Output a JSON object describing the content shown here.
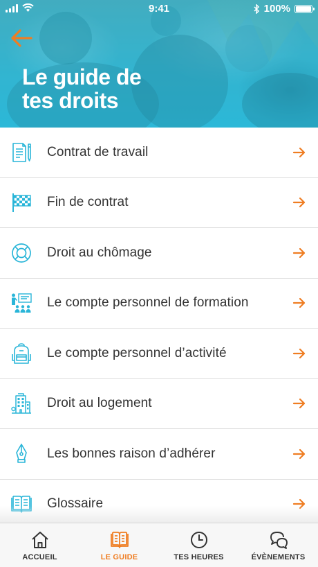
{
  "colors": {
    "accent": "#ef7d22",
    "icon_teal": "#29b5d8",
    "header_blue": "#34b4cf",
    "text": "#333333"
  },
  "status_bar": {
    "time": "9:41",
    "battery": "100%"
  },
  "header": {
    "back_icon": "arrow-left-icon",
    "title_line1": "Le guide de",
    "title_line2": "tes droits"
  },
  "list": {
    "items": [
      {
        "label": "Contrat de travail",
        "icon": "contract-document-icon"
      },
      {
        "label": "Fin de contrat",
        "icon": "checkered-flag-icon"
      },
      {
        "label": "Droit au chômage",
        "icon": "lifebuoy-icon"
      },
      {
        "label": "Le compte personnel de formation",
        "icon": "training-presentation-icon"
      },
      {
        "label": "Le compte personnel d’activité",
        "icon": "backpack-icon"
      },
      {
        "label": "Droit au logement",
        "icon": "building-icon"
      },
      {
        "label": "Les bonnes raison d’adhérer",
        "icon": "fountain-pen-icon"
      },
      {
        "label": "Glossaire",
        "icon": "open-book-icon"
      }
    ]
  },
  "tabbar": {
    "tabs": [
      {
        "label": "ACCUEIL",
        "icon": "home-icon",
        "active": false
      },
      {
        "label": "LE GUIDE",
        "icon": "book-icon",
        "active": true
      },
      {
        "label": "TES HEURES",
        "icon": "clock-icon",
        "active": false
      },
      {
        "label": "ÉVÈNEMENTS",
        "icon": "chat-bubbles-icon",
        "active": false
      }
    ]
  }
}
